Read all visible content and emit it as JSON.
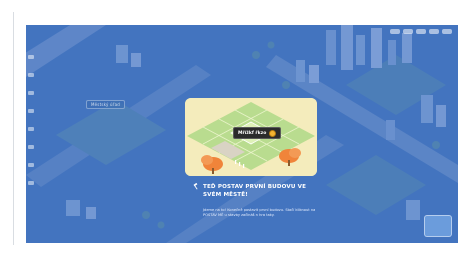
{
  "colors": {
    "overlay": "#2f66c7",
    "dialog_heading": "#ffffff",
    "dialog_body": "#e7efff",
    "button_bg": "#2b2b2b",
    "coin": "#f3b331",
    "tile_light": "#c6e3a4",
    "tile_grass": "#a9d181",
    "tree_orange": "#f0843a"
  },
  "world": {
    "tag_label": "Městský úřad"
  },
  "dialog": {
    "select_tile_label": "Mřížkf řkzo",
    "heading": "Teď postav první budovu ve svém městě!",
    "body": "Jdeme na to! Konečně postavit první budovu. Stačí kliknout na POSTAV MĚ u stavby začínáš n hra taky."
  },
  "icons": {
    "select_tile": "coin-icon",
    "heading": "hammer-icon"
  }
}
